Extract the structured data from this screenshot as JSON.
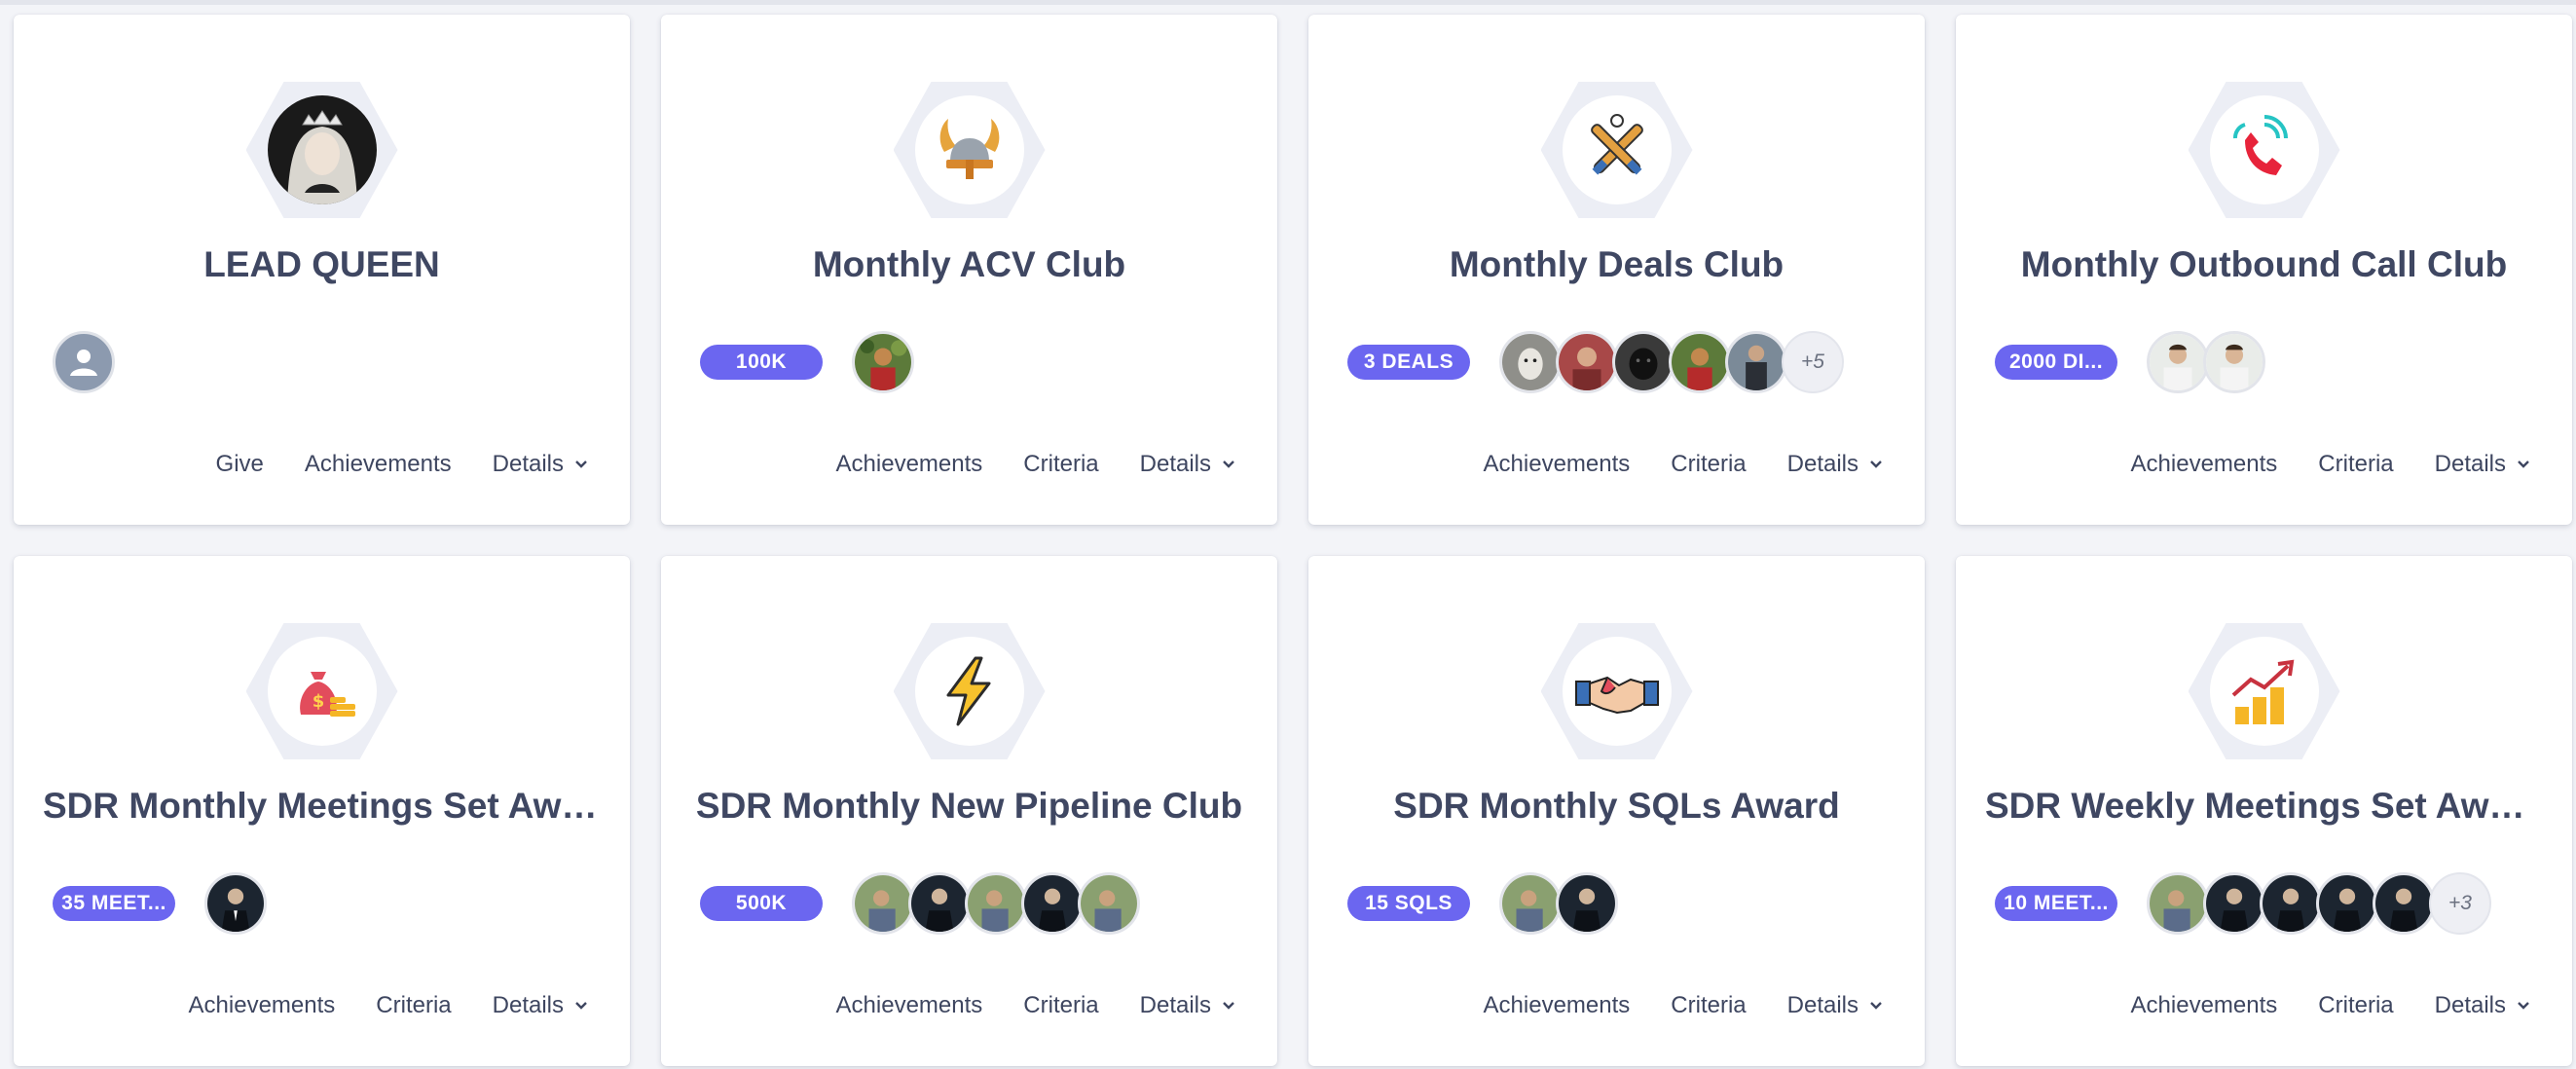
{
  "colors": {
    "accent": "#6b66f0",
    "card_bg": "#ffffff",
    "page_bg": "#f3f4f8",
    "hex_bg": "#eceef5"
  },
  "cards": [
    {
      "title": "LEAD QUEEN",
      "icon": "queen-portrait-icon",
      "badge": "",
      "more": "",
      "actions": [
        "Give",
        "Achievements",
        "Details"
      ]
    },
    {
      "title": "Monthly ACV Club",
      "icon": "viking-helmet-icon",
      "badge": "100K",
      "more": "",
      "actions": [
        "Achievements",
        "Criteria",
        "Details"
      ]
    },
    {
      "title": "Monthly Deals Club",
      "icon": "crossed-bats-icon",
      "badge": "3 DEALS",
      "more": "+5",
      "actions": [
        "Achievements",
        "Criteria",
        "Details"
      ]
    },
    {
      "title": "Monthly Outbound Call Club",
      "icon": "phone-call-icon",
      "badge": "2000 DI...",
      "more": "",
      "actions": [
        "Achievements",
        "Criteria",
        "Details"
      ]
    },
    {
      "title": "SDR Monthly Meetings Set Awa...",
      "icon": "money-bag-icon",
      "badge": "35 MEET...",
      "more": "",
      "actions": [
        "Achievements",
        "Criteria",
        "Details"
      ]
    },
    {
      "title": "SDR Monthly New Pipeline Club",
      "icon": "lightning-bolt-icon",
      "badge": "500K",
      "more": "",
      "actions": [
        "Achievements",
        "Criteria",
        "Details"
      ]
    },
    {
      "title": "SDR Monthly SQLs Award",
      "icon": "handshake-icon",
      "badge": "15 SQLS",
      "more": "",
      "actions": [
        "Achievements",
        "Criteria",
        "Details"
      ]
    },
    {
      "title": "SDR Weekly Meetings Set Award",
      "icon": "growth-chart-icon",
      "badge": "10 MEET...",
      "more": "+3",
      "actions": [
        "Achievements",
        "Criteria",
        "Details"
      ]
    }
  ]
}
